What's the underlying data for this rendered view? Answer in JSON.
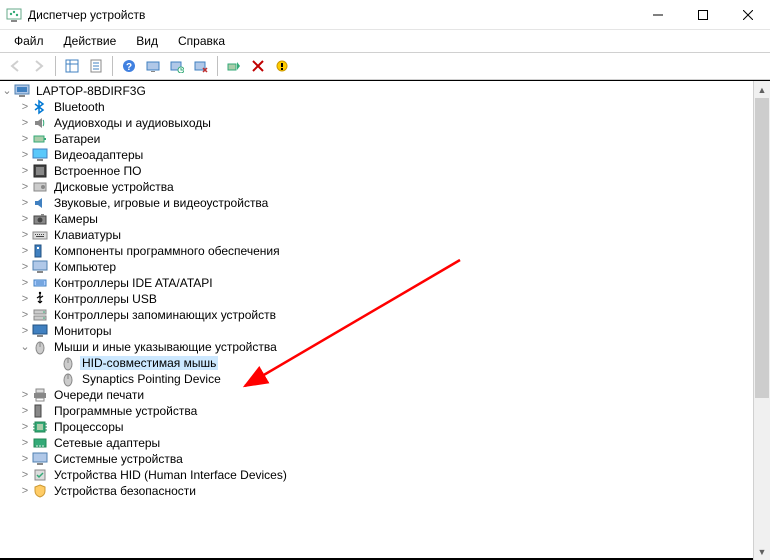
{
  "window": {
    "title": "Диспетчер устройств"
  },
  "menu": {
    "file": "Файл",
    "action": "Действие",
    "view": "Вид",
    "help": "Справка"
  },
  "tree": {
    "root": "LAPTOP-8BDIRF3G",
    "nodes": [
      "Bluetooth",
      "Аудиовходы и аудиовыходы",
      "Батареи",
      "Видеоадаптеры",
      "Встроенное ПО",
      "Дисковые устройства",
      "Звуковые, игровые и видеоустройства",
      "Камеры",
      "Клавиатуры",
      "Компоненты программного обеспечения",
      "Компьютер",
      "Контроллеры IDE ATA/ATAPI",
      "Контроллеры USB",
      "Контроллеры запоминающих устройств",
      "Мониторы"
    ],
    "mice_category": "Мыши и иные указывающие устройства",
    "mice_children": [
      "HID-совместимая мышь",
      "Synaptics Pointing Device"
    ],
    "after_mice": [
      "Очереди печати",
      "Программные устройства",
      "Процессоры",
      "Сетевые адаптеры",
      "Системные устройства",
      "Устройства HID (Human Interface Devices)",
      "Устройства безопасности"
    ]
  }
}
